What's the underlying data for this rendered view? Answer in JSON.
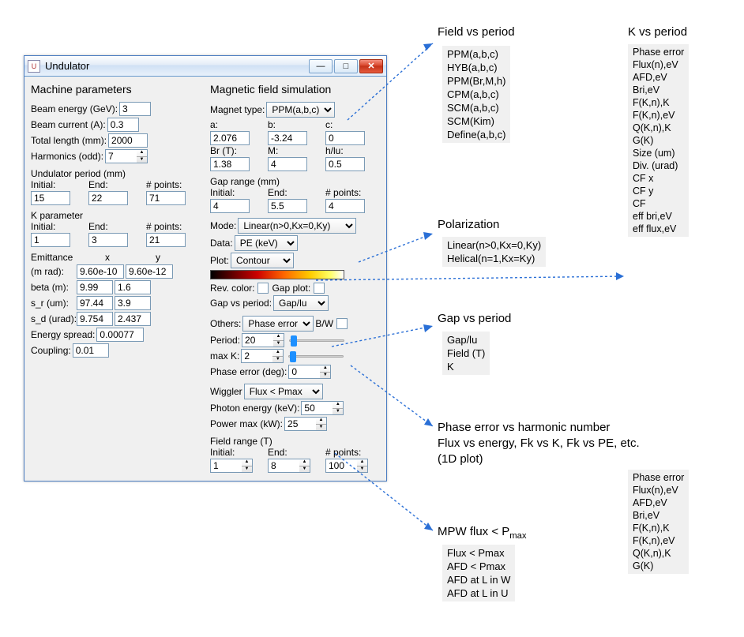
{
  "window": {
    "title": "Undulator"
  },
  "left": {
    "heading": "Machine parameters",
    "beam_energy_lbl": "Beam energy (GeV):",
    "beam_energy": "3",
    "beam_current_lbl": "Beam current (A):",
    "beam_current": "0.3",
    "total_len_lbl": "Total length (mm):",
    "total_len": "2000",
    "harmonics_lbl": "Harmonics (odd):",
    "harmonics": "7",
    "und_period_lbl": "Undulator period (mm)",
    "initial_lbl": "Initial:",
    "end_lbl": "End:",
    "pts_lbl": "# points:",
    "up_initial": "15",
    "up_end": "22",
    "up_pts": "71",
    "kparam_lbl": "K parameter",
    "kp_initial": "1",
    "kp_end": "3",
    "kp_pts": "21",
    "emit_lbl": "Emittance",
    "x_lbl": "x",
    "y_lbl": "y",
    "mrad_lbl": "(m rad):",
    "mrad_x": "9.60e-10",
    "mrad_y": "9.60e-12",
    "beta_lbl": "beta (m):",
    "beta_x": "9.99",
    "beta_y": "1.6",
    "sr_lbl": "s_r (um):",
    "sr_x": "97.44",
    "sr_y": "3.9",
    "sd_lbl": "s_d (urad):",
    "sd_x": "9.754",
    "sd_y": "2.437",
    "espread_lbl": "Energy spread:",
    "espread": "0.00077",
    "coupling_lbl": "Coupling:",
    "coupling": "0.01"
  },
  "right": {
    "heading": "Magnetic field simulation",
    "magtype_lbl": "Magnet type:",
    "magtype": "PPM(a,b,c)",
    "a_lbl": "a:",
    "b_lbl": "b:",
    "c_lbl": "c:",
    "a": "2.076",
    "b": "-3.24",
    "c": "0",
    "br_lbl": "Br (T):",
    "m_lbl": "M:",
    "hlu_lbl": "h/lu:",
    "br": "1.38",
    "m": "4",
    "hlu": "0.5",
    "gap_lbl": "Gap range (mm)",
    "gap_initial": "4",
    "gap_end": "5.5",
    "gap_pts": "4",
    "mode_lbl": "Mode:",
    "mode": "Linear(n>0,Kx=0,Ky)",
    "data_lbl": "Data:",
    "data": "PE (keV)",
    "plot_lbl": "Plot:",
    "plot": "Contour",
    "revcolor_lbl": "Rev. color:",
    "gapplot_lbl": "Gap plot:",
    "gapvp_lbl": "Gap vs period:",
    "gapvp": "Gap/lu",
    "others_lbl": "Others:",
    "others": "Phase error",
    "bw_lbl": "B/W",
    "period_lbl": "Period:",
    "period": "20",
    "maxk_lbl": "max K:",
    "maxk": "2",
    "pe_lbl": "Phase error (deg):",
    "pe": "0",
    "wiggler_lbl": "Wiggler",
    "wiggler": "Flux < Pmax",
    "phe_lbl": "Photon energy (keV):",
    "phe": "50",
    "pmax_lbl": "Power max (kW):",
    "pmax": "25",
    "fr_lbl": "Field range (T)",
    "fr_initial": "1",
    "fr_end": "8",
    "fr_pts": "100"
  },
  "callouts": {
    "field_vs_period": "Field vs period",
    "polarization": "Polarization",
    "gap_vs_period": "Gap vs period",
    "k_vs_period": "K vs period",
    "phase_err": "Phase error vs harmonic number",
    "flux_etc": "Flux vs energy, Fk vs K, Fk vs PE, etc.",
    "oneD": "(1D plot)",
    "mpw": "MPW flux < P"
  },
  "lists": {
    "field_period": [
      "PPM(a,b,c)",
      "HYB(a,b,c)",
      "PPM(Br,M,h)",
      "CPM(a,b,c)",
      "SCM(a,b,c)",
      "SCM(Kim)",
      "Define(a,b,c)"
    ],
    "polarization": [
      "Linear(n>0,Kx=0,Ky)",
      "Helical(n=1,Kx=Ky)"
    ],
    "gap_period": [
      "Gap/lu",
      "Field (T)",
      "K"
    ],
    "mpw": [
      "Flux < Pmax",
      "AFD < Pmax",
      "AFD at L in W",
      "AFD at L in U"
    ],
    "k_period": [
      "Phase error",
      "Flux(n),eV",
      "AFD,eV",
      "Bri,eV",
      "F(K,n),K",
      "F(K,n),eV",
      "Q(K,n),K",
      "G(K)",
      "Size (um)",
      "Div. (urad)",
      "CF x",
      "CF y",
      "CF",
      "eff bri,eV",
      "eff flux,eV"
    ],
    "others_list": [
      "Phase error",
      "Flux(n),eV",
      "AFD,eV",
      "Bri,eV",
      "F(K,n),K",
      "F(K,n),eV",
      "Q(K,n),K",
      "G(K)"
    ]
  }
}
